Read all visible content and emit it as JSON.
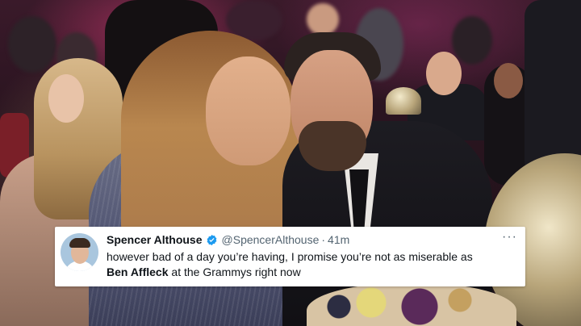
{
  "tweet": {
    "display_name": "Spencer Althouse",
    "handle": "@SpencerAlthouse",
    "separator": "·",
    "time": "41m",
    "more": "···",
    "line1": "however bad of a day you’re having, I promise you’re not as miserable as",
    "line2_bold": "Ben Affleck",
    "line2_rest": " at the Grammys right now",
    "verified_color": "#1d9bf0"
  },
  "icons": {
    "avatar": "profile-photo",
    "verified": "verified-badge-icon",
    "more": "more-options-icon"
  }
}
